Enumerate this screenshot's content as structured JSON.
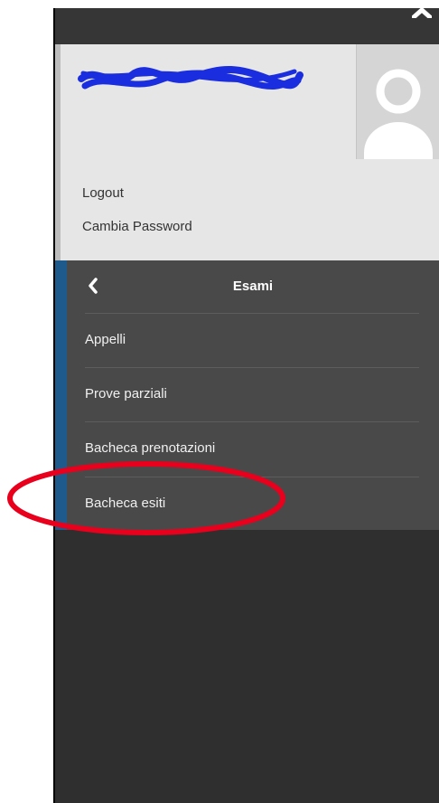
{
  "user": {
    "logout_label": "Logout",
    "change_password_label": "Cambia Password"
  },
  "menu": {
    "title": "Esami",
    "items": [
      {
        "label": "Appelli"
      },
      {
        "label": "Prove parziali"
      },
      {
        "label": "Bacheca prenotazioni"
      },
      {
        "label": "Bacheca esiti"
      }
    ]
  },
  "icons": {
    "collapse": "chevron-up-icon",
    "back": "chevron-left-icon",
    "avatar": "user-placeholder-icon"
  },
  "colors": {
    "panel_background": "#2f2f2f",
    "user_card_background": "#e6e6e6",
    "menu_background": "#494949",
    "menu_accent": "#1f5a8c",
    "highlight_annotation": "#e8001c",
    "redaction_scribble": "#1a2ee0"
  }
}
